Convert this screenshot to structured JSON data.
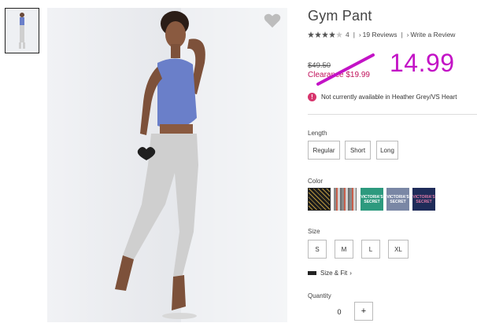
{
  "product": {
    "title": "Gym Pant",
    "rating": 4,
    "rating_text": "4",
    "reviews_label": "19 Reviews",
    "write_review_label": "Write a Review"
  },
  "pricing": {
    "original_price": "$49.50",
    "clearance_label": "Clearance $19.99",
    "annotation_price": "14.99",
    "accent_color": "#c1125c",
    "annotation_color": "#c313c6"
  },
  "notice": {
    "text": "Not currently available in Heather Grey/VS Heart"
  },
  "length": {
    "label": "Length",
    "options": [
      "Regular",
      "Short",
      "Long"
    ]
  },
  "color": {
    "label": "Color",
    "swatches": [
      {
        "name": "gold-sequin-swatch",
        "text": ""
      },
      {
        "name": "stripe-swatch",
        "text": ""
      },
      {
        "name": "green-logo-swatch",
        "text": "VICTORIA'S SECRET"
      },
      {
        "name": "grey-logo-swatch",
        "text": "VICTORIA'S SECRET"
      },
      {
        "name": "navy-logo-swatch",
        "text": "VICTORIA'S SECRET"
      }
    ]
  },
  "size": {
    "label": "Size",
    "options": [
      "S",
      "M",
      "L",
      "XL"
    ],
    "size_fit_label": "Size & Fit"
  },
  "quantity": {
    "label": "Quantity",
    "value": "0",
    "plus_label": "+"
  },
  "icons": {
    "heart": "heart-icon",
    "alert": "alert-icon",
    "star": "star-icon",
    "ruler": "ruler-icon"
  }
}
